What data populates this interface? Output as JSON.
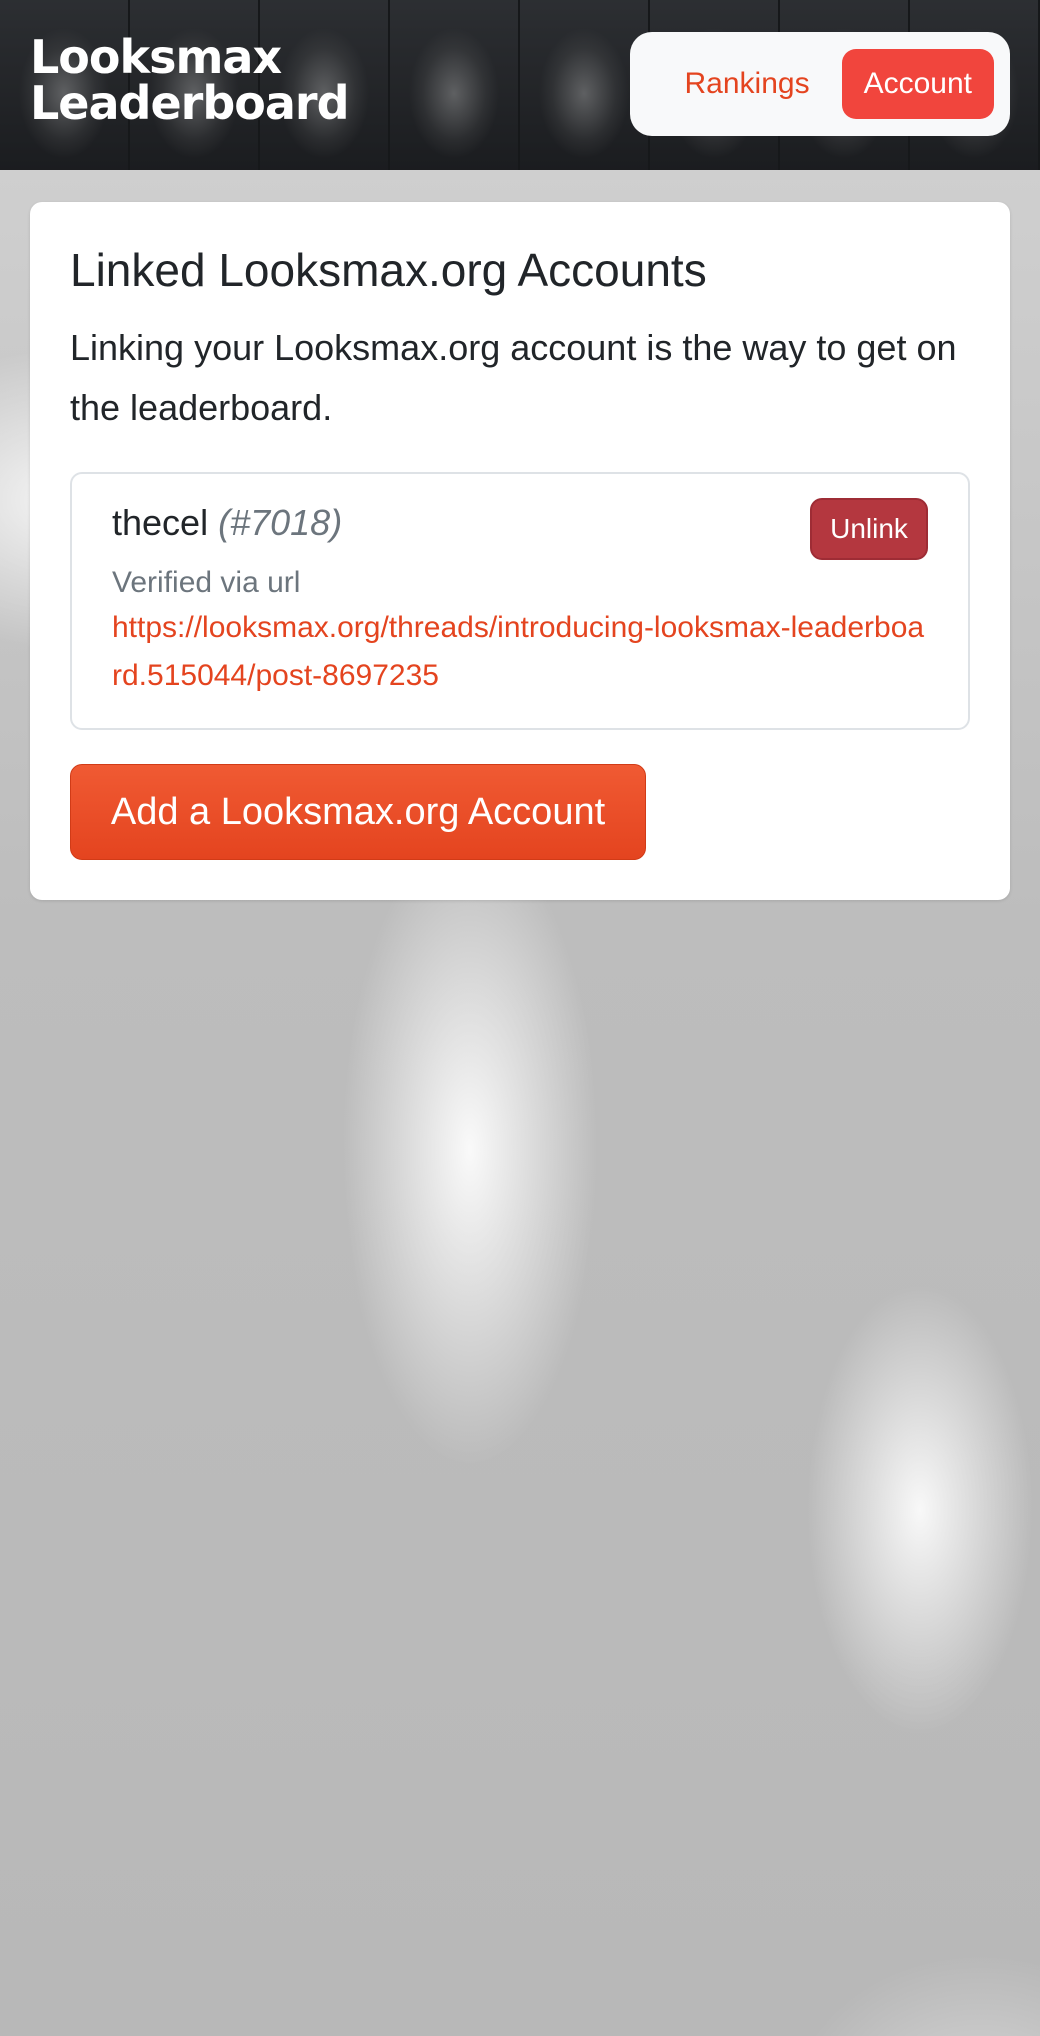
{
  "header": {
    "logo_line1": "Looksmax",
    "logo_line2": "Leaderboard",
    "nav": {
      "rankings": "Rankings",
      "account": "Account"
    }
  },
  "main": {
    "title": "Linked Looksmax.org Accounts",
    "lead": "Linking your Looksmax.org account is the way to get on the leaderboard.",
    "accounts": [
      {
        "username": "thecel",
        "id": "(#7018)",
        "verified_text": "Verified via url",
        "url": "https://looksmax.org/threads/introducing-looksmax-leaderboard.515044/post-8697235",
        "unlink_label": "Unlink"
      }
    ],
    "add_button": "Add a Looksmax.org Account"
  },
  "colors": {
    "accent": "#e4441f",
    "account_button": "#f1453d",
    "unlink": "#b4373f"
  }
}
